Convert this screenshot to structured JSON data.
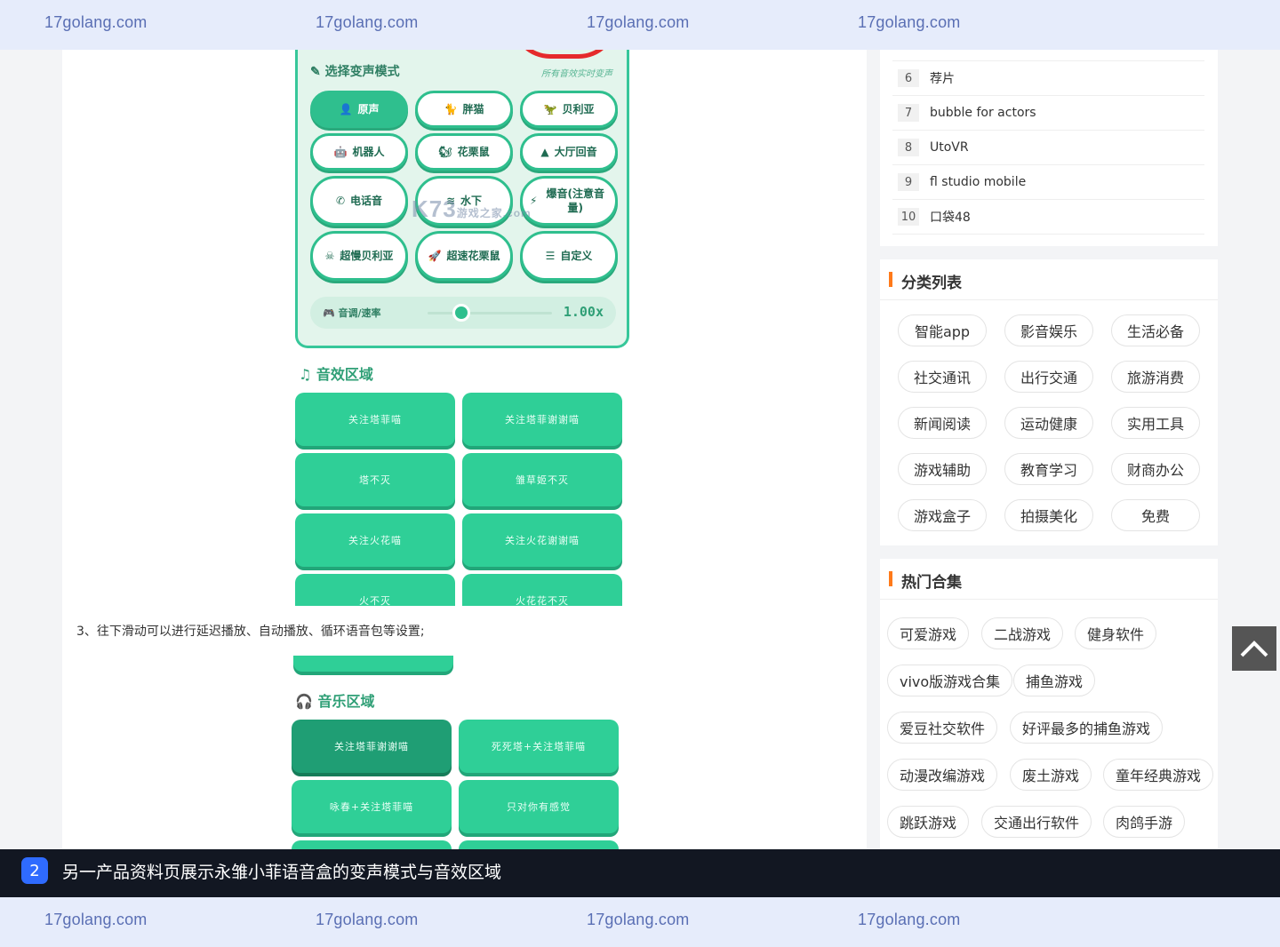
{
  "watermark": {
    "text": "17golang.com"
  },
  "app_shot": {
    "mode_title": "选择变声模式",
    "mode_subtitle": "所有音效实时变声",
    "modes": [
      {
        "label": "原声",
        "icon": "person-icon",
        "active": true
      },
      {
        "label": "胖猫",
        "icon": "cat-icon",
        "active": false
      },
      {
        "label": "贝利亚",
        "icon": "monster-icon",
        "active": false
      },
      {
        "label": "机器人",
        "icon": "robot-icon",
        "active": false
      },
      {
        "label": "花栗鼠",
        "icon": "squirrel-icon",
        "active": false
      },
      {
        "label": "大厅回音",
        "icon": "hall-icon",
        "active": false
      },
      {
        "label": "电话音",
        "icon": "phone-icon",
        "active": false
      },
      {
        "label": "水下",
        "icon": "water-icon",
        "active": false
      },
      {
        "label": "爆音(注意音量)",
        "icon": "lightning-icon",
        "active": false
      },
      {
        "label": "超慢贝利亚",
        "icon": "skull-icon",
        "active": false
      },
      {
        "label": "超速花栗鼠",
        "icon": "rocket-icon",
        "active": false
      },
      {
        "label": "自定义",
        "icon": "sliders-icon",
        "active": false
      }
    ],
    "watermark_logo": "K73",
    "watermark_sub": "游戏之家",
    "watermark_domain": ".com",
    "pitch_label": "音调/速率",
    "pitch_value": "1.00x",
    "pitch_level": 0.2,
    "sfx_title": "音效区域",
    "sfx_buttons": [
      "关注塔菲喵",
      "关注塔菲谢谢喵",
      "塔不灭",
      "雏草姬不灭",
      "关注火花喵",
      "关注火花谢谢喵",
      "火不灭",
      "火花花不灭"
    ],
    "music_title": "音乐区域",
    "music_buttons": [
      "关注塔菲谢谢喵",
      "死死塔+关注塔菲喵",
      "咏春+关注塔菲喵",
      "只对你有感觉"
    ]
  },
  "article": {
    "caption": "3、往下滑动可以进行延迟播放、自动播放、循环语音包等设置;"
  },
  "ranking": [
    {
      "num": "6",
      "name": "荐片"
    },
    {
      "num": "7",
      "name": "bubble for actors"
    },
    {
      "num": "8",
      "name": "UtoVR"
    },
    {
      "num": "9",
      "name": "fl studio mobile"
    },
    {
      "num": "10",
      "name": "口袋48"
    }
  ],
  "categories": {
    "title": "分类列表",
    "items": [
      "智能app",
      "影音娱乐",
      "生活必备",
      "社交通讯",
      "出行交通",
      "旅游消费",
      "新闻阅读",
      "运动健康",
      "实用工具",
      "游戏辅助",
      "教育学习",
      "财商办公",
      "游戏盒子",
      "拍摄美化",
      "免费"
    ]
  },
  "hot": {
    "title": "热门合集",
    "rows": [
      [
        "可爱游戏",
        "二战游戏",
        "健身软件"
      ],
      [
        "vivo版游戏合集",
        "捕鱼游戏"
      ],
      [
        "爱豆社交软件",
        "好评最多的捕鱼游戏"
      ],
      [
        "动漫改编游戏",
        "废土游戏",
        "童年经典游戏"
      ],
      [
        "跳跃游戏",
        "交通出行软件",
        "肉鸽手游"
      ]
    ]
  },
  "caption_bar": {
    "index": "2",
    "text": "另一产品资料页展示永雏小菲语音盒的变声模式与音效区域"
  },
  "colors": {
    "accent_green": "#2fbf8e",
    "orange_bar": "#ff7a1a",
    "badge_blue": "#2f6bff"
  }
}
